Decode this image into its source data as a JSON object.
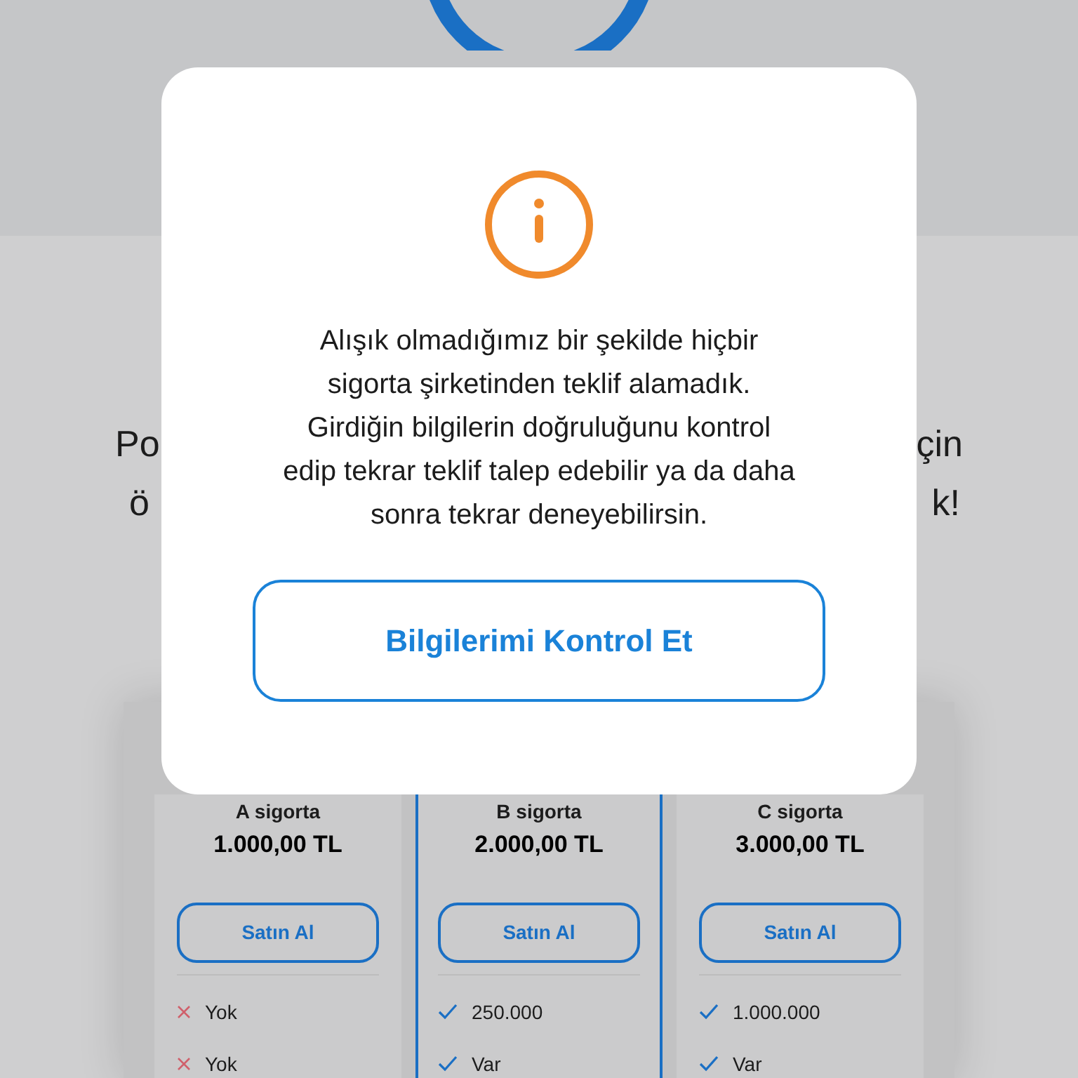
{
  "background_text": {
    "line_1": {
      "left": "Po",
      "right": "çin"
    },
    "line_2": {
      "left": "ö",
      "right": "k!"
    }
  },
  "plans": [
    {
      "name": "A sigorta",
      "price": "1.000,00 TL",
      "button": "Satın Al",
      "selected": false,
      "features": [
        {
          "text": "Yok",
          "included": false
        },
        {
          "text": "Yok",
          "included": false
        }
      ]
    },
    {
      "name": "B sigorta",
      "price": "2.000,00 TL",
      "button": "Satın Al",
      "selected": true,
      "features": [
        {
          "text": "250.000",
          "included": true
        },
        {
          "text": "Var",
          "included": true
        }
      ]
    },
    {
      "name": "C sigorta",
      "price": "3.000,00 TL",
      "button": "Satın Al",
      "selected": false,
      "features": [
        {
          "text": "1.000.000",
          "included": true
        },
        {
          "text": "Var",
          "included": true
        }
      ]
    }
  ],
  "dialog": {
    "message": "Alışık olmadığımız bir şekilde hiçbir sigorta şirketinden teklif alamadık. Girdiğin bilgilerin doğruluğunu kontrol edip tekrar teklif talep edebilir ya da daha sonra tekrar deneyebilirsin.",
    "button": "Bilgilerimi Kontrol Et"
  }
}
